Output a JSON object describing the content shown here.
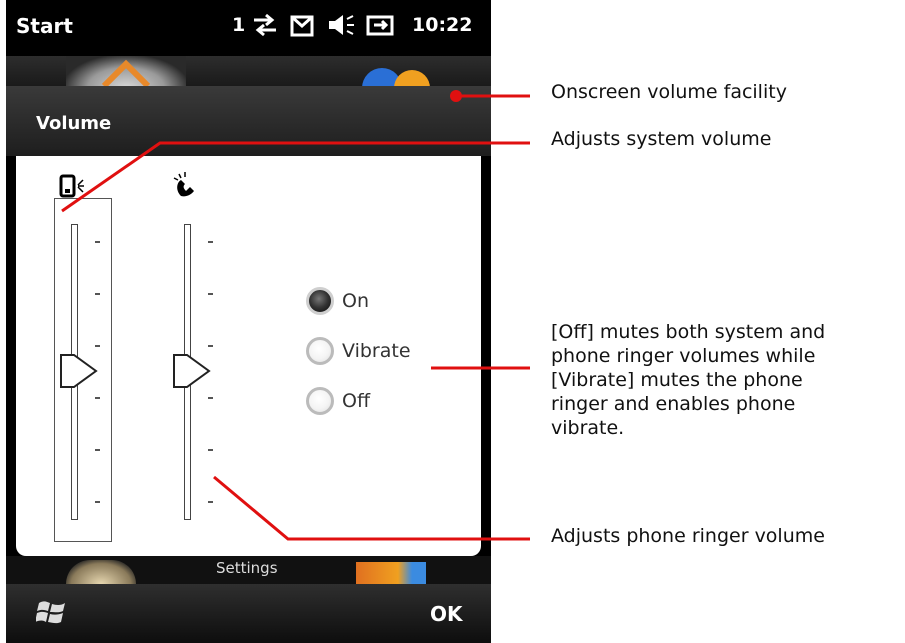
{
  "statusbar": {
    "start": "Start",
    "signal_number": "1",
    "time": "10:22",
    "icons": [
      "data-sync-icon",
      "sim-message-icon",
      "speaker-icon",
      "battery-charging-icon"
    ]
  },
  "dialog": {
    "title": "Volume",
    "system_icon": "phone-speaker-icon",
    "ringer_icon": "phone-ringer-icon",
    "system_volume_level": 0.5,
    "ringer_volume_level": 0.5,
    "ring_mode": {
      "options": [
        "On",
        "Vibrate",
        "Off"
      ],
      "selected": "On"
    }
  },
  "home": {
    "settings_label": "Settings"
  },
  "softkeys": {
    "left_icon": "windows-start-icon",
    "right": "OK"
  },
  "annotations": {
    "onscreen": "Onscreen volume facility",
    "system": "Adjusts system volume",
    "off_vibrate": [
      "[Off] mutes both system and",
      "phone ringer volumes while",
      "[Vibrate] mutes the phone",
      "ringer and enables phone",
      "vibrate."
    ],
    "ringer": "Adjusts phone ringer volume"
  },
  "colors": {
    "callout_line": "#e01010"
  }
}
